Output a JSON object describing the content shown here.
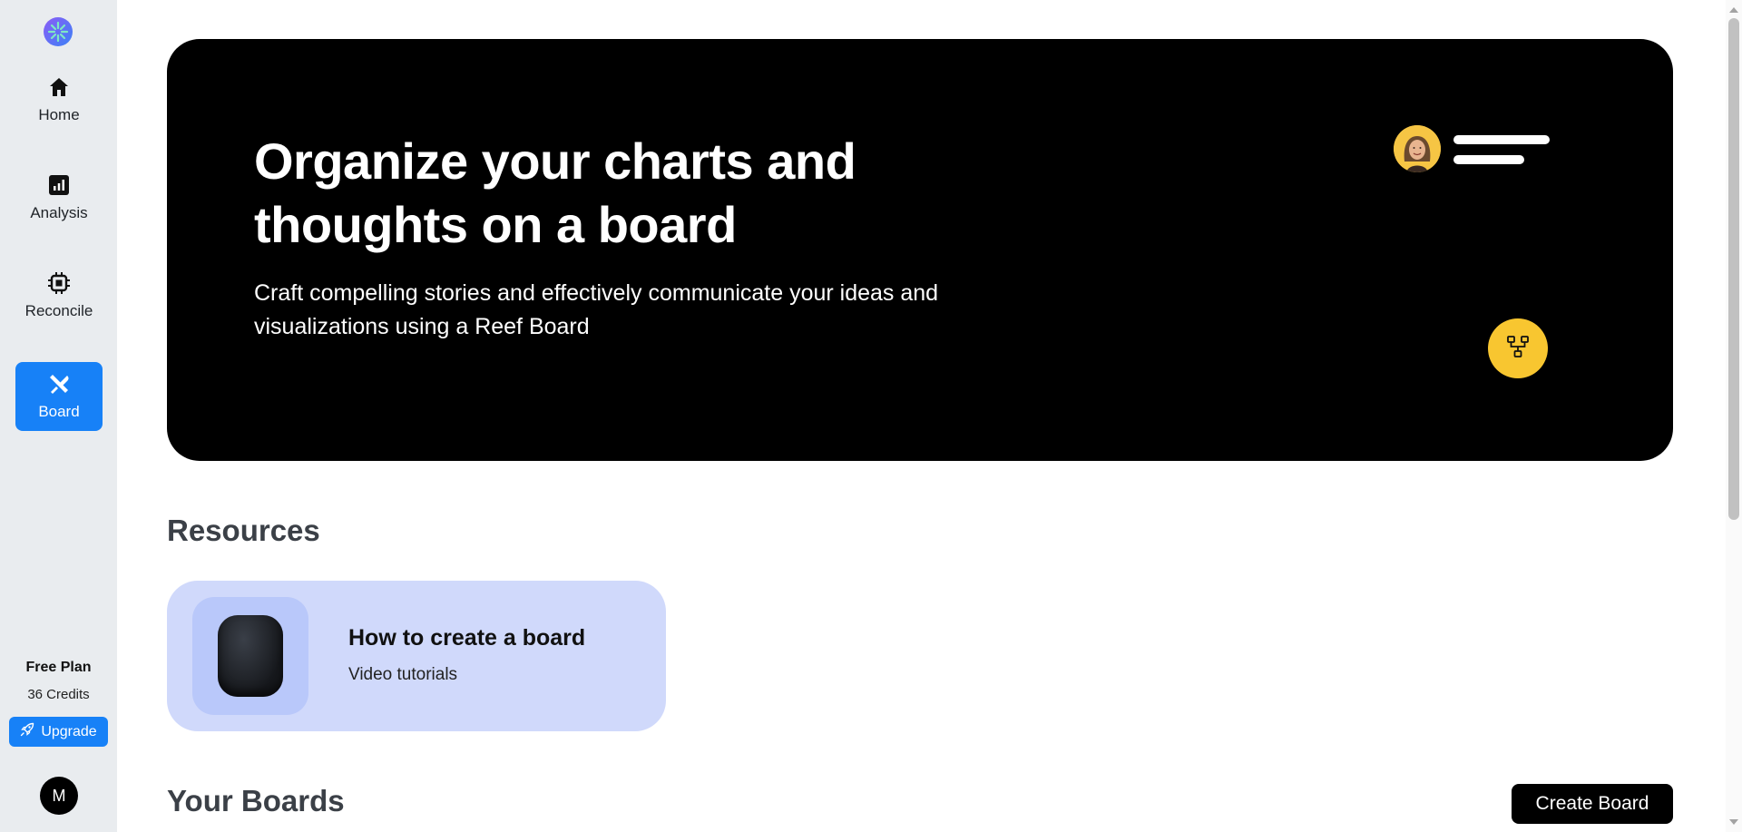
{
  "sidebar": {
    "logo_icon": "app-logo-icon",
    "items": [
      {
        "label": "Home",
        "icon": "home-icon",
        "active": false
      },
      {
        "label": "Analysis",
        "icon": "bar-chart-icon",
        "active": false
      },
      {
        "label": "Reconcile",
        "icon": "chip-icon",
        "active": false
      },
      {
        "label": "Board",
        "icon": "board-tools-icon",
        "active": true
      }
    ],
    "plan": {
      "title": "Free Plan",
      "credits": "36 Credits",
      "upgrade_label": "Upgrade",
      "upgrade_icon": "rocket-icon"
    },
    "avatar_initial": "M"
  },
  "hero": {
    "title_line1": "Organize your charts and",
    "title_line2": "thoughts on a board",
    "subtitle_line1": "Craft compelling stories and effectively communicate your ideas and",
    "subtitle_line2": "visualizations using a Reef Board",
    "avatar_icon": "user-photo-icon",
    "flow_icon": "flowchart-icon"
  },
  "resources": {
    "title": "Resources",
    "card": {
      "title": "How to create a board",
      "subtitle": "Video tutorials",
      "thumb_icon": "speaker-image"
    }
  },
  "boards": {
    "title": "Your Boards",
    "create_label": "Create Board"
  },
  "colors": {
    "accent": "#1781f7",
    "sidebar_bg": "#e9ecef",
    "hero_bg": "#000000",
    "yellow": "#f8c630",
    "resource_card_bg": "#d0d9fb"
  }
}
